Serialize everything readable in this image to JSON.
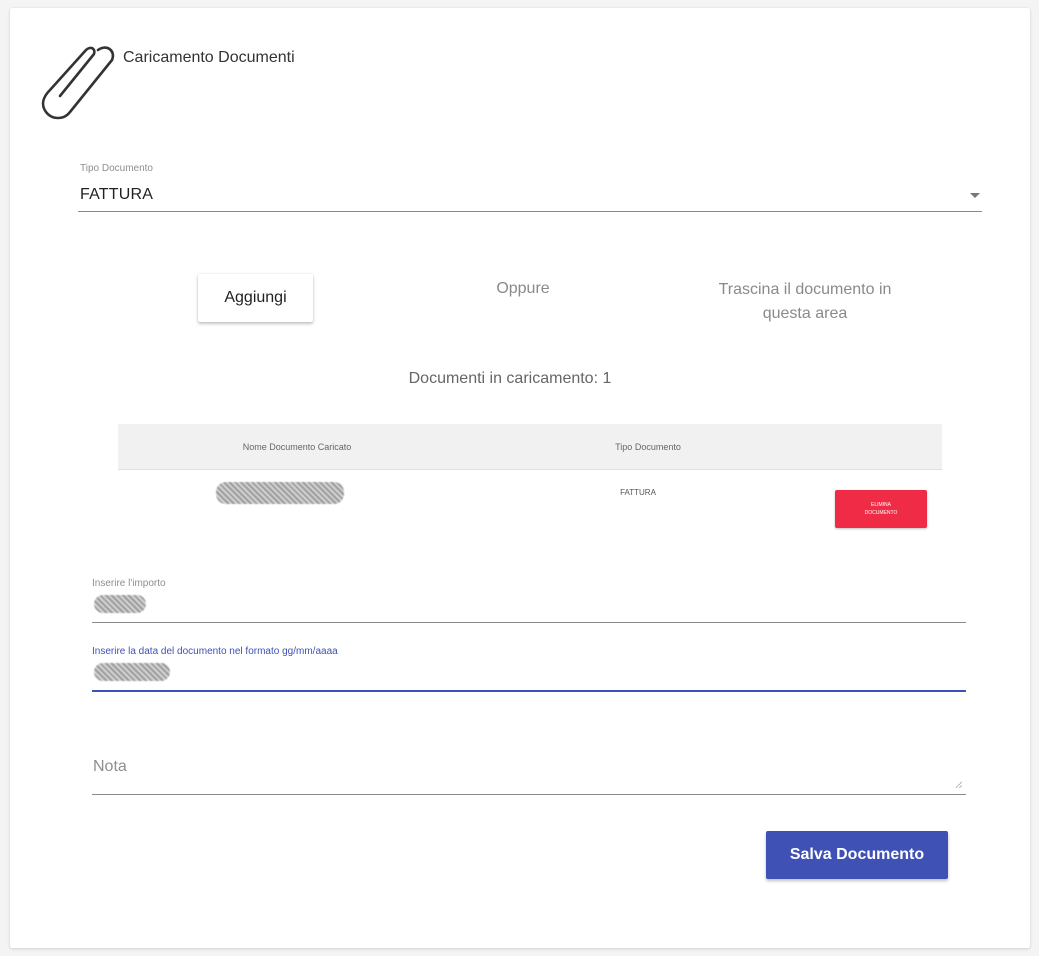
{
  "header": {
    "title": "Caricamento Documenti",
    "icon": "paperclip-icon"
  },
  "document_type": {
    "label": "Tipo Documento",
    "value": "FATTURA",
    "icon": "dropdown-arrow-icon"
  },
  "upload": {
    "add_label": "Aggiungi",
    "or_label": "Oppure",
    "drag_label": "Trascina il documento in questa area",
    "uploading_label": "Documenti in caricamento: 1"
  },
  "table": {
    "headers": {
      "name": "Nome Documento Caricato",
      "type": "Tipo Documento"
    },
    "rows": [
      {
        "type": "FATTURA",
        "delete_label": "ELIMINA\nDOCUMENTO"
      }
    ]
  },
  "form": {
    "amount_label": "Inserire l'importo",
    "date_label": "Inserire la data del documento nel formato gg/mm/aaaa",
    "note_placeholder": "Nota"
  },
  "actions": {
    "save_label": "Salva Documento"
  },
  "colors": {
    "primary": "#3f51b5",
    "danger": "#ef2b46"
  }
}
